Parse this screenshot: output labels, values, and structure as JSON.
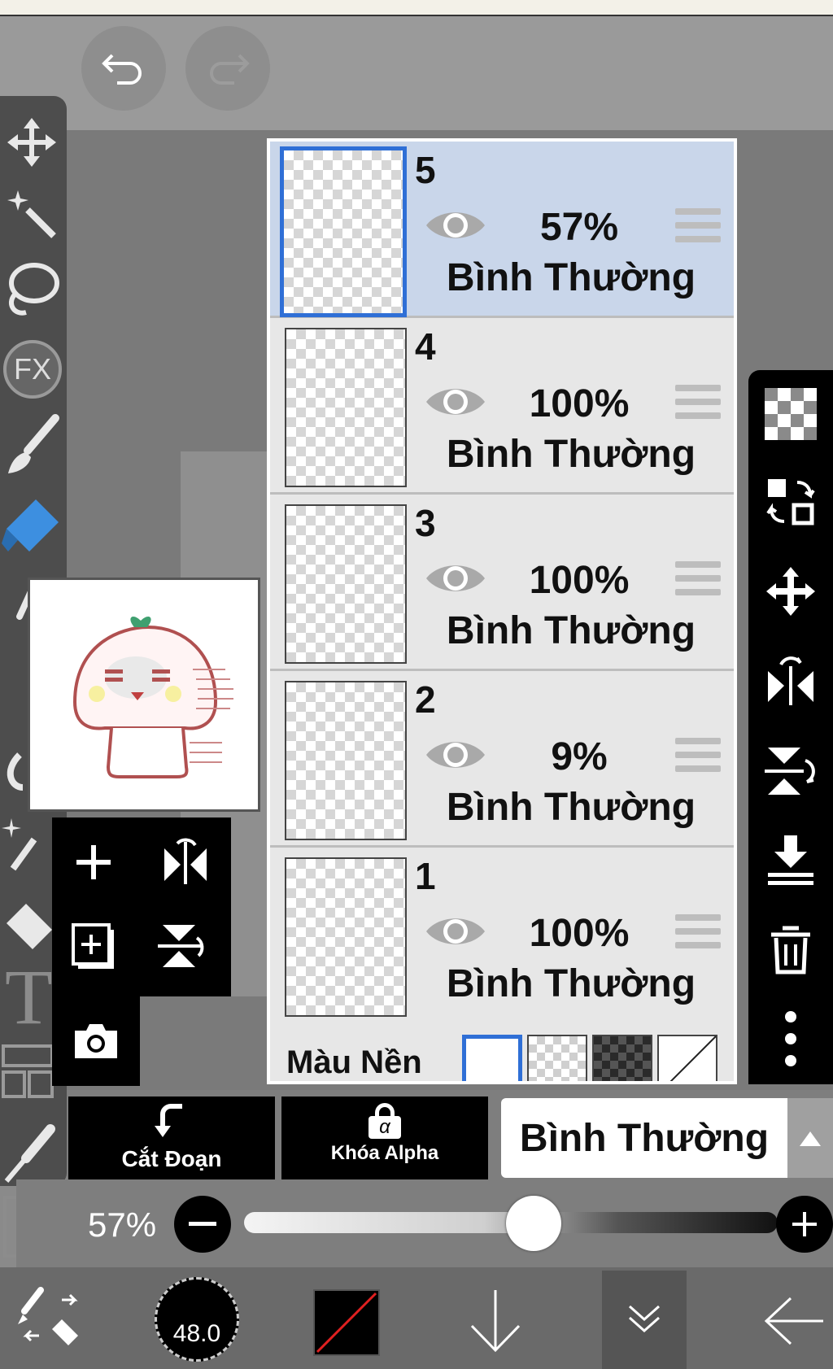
{
  "toolbar": {
    "undo": "undo",
    "redo": "redo"
  },
  "left_tools": [
    "move-icon",
    "magic-wand-icon",
    "lasso-icon",
    "fx-icon",
    "brush-icon",
    "eraser-icon",
    "smudge-icon",
    "blur-icon",
    "bucket-icon",
    "text-icon",
    "frame-icon",
    "eyedropper-icon",
    "canvas-icon"
  ],
  "left_tool_labels": {
    "fx": "FX",
    "text": "T"
  },
  "layers": [
    {
      "number": "5",
      "opacity": "57%",
      "blend": "Bình Thường",
      "selected": true
    },
    {
      "number": "4",
      "opacity": "100%",
      "blend": "Bình Thường",
      "selected": false
    },
    {
      "number": "3",
      "opacity": "100%",
      "blend": "Bình Thường",
      "selected": false
    },
    {
      "number": "2",
      "opacity": "9%",
      "blend": "Bình Thường",
      "selected": false
    },
    {
      "number": "1",
      "opacity": "100%",
      "blend": "Bình Thường",
      "selected": false
    }
  ],
  "background": {
    "label": "Màu Nền"
  },
  "bottom_controls": {
    "clip_label": "Cắt Đoạn",
    "alpha_lock_label": "Khóa Alpha",
    "alpha_symbol": "α",
    "blend_mode": "Bình Thường"
  },
  "opacity_slider": {
    "label": "57%",
    "value": 0.57
  },
  "bottom_bar": {
    "brush_size": "48.0"
  },
  "colors": {
    "selected_layer_bg": "#c9d6ea",
    "selected_border": "#2f6fd6"
  }
}
